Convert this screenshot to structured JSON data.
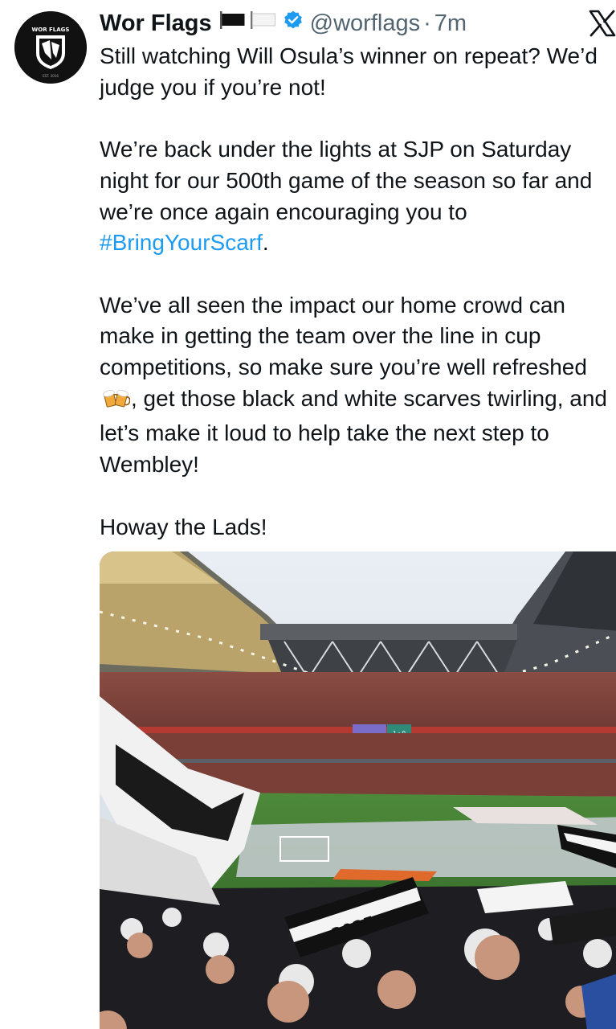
{
  "author": {
    "display_name": "Wor Flags",
    "handle": "@worflags",
    "separator": "·",
    "timestamp": "7m",
    "avatar_text": "WOR FLAGS",
    "avatar_subtext": "EST. 2016",
    "verified": true
  },
  "tweet": {
    "line1": "Still watching Will Osula’s winner on repeat? We’d judge you if you’re not!",
    "para2_text": "We’re back under the lights at SJP on Saturday night for our 500th game of the season so far and we’re once again encouraging you to ",
    "hashtag": "#BringYourScarf",
    "para2_end": ".",
    "para3_before_emoji": "We’ve all seen the impact our home crowd can make in getting the team over the line in cup competitions, so make sure you’re well refreshed",
    "para3_after_emoji": ", get those black and white scarves twirling, and let’s make it loud to help take the next step to Wembley!",
    "para4": "Howay the Lads!"
  },
  "media": {
    "scarf_text": "2025",
    "scoreboard": "1 - 0"
  },
  "colors": {
    "text": "#0f1419",
    "secondary": "#536471",
    "link": "#1d9bf0",
    "verified": "#1d9bf0"
  },
  "icons": [
    "black-flag-icon",
    "white-flag-icon",
    "verified-badge-icon",
    "x-logo-icon",
    "beer-mugs-emoji"
  ]
}
